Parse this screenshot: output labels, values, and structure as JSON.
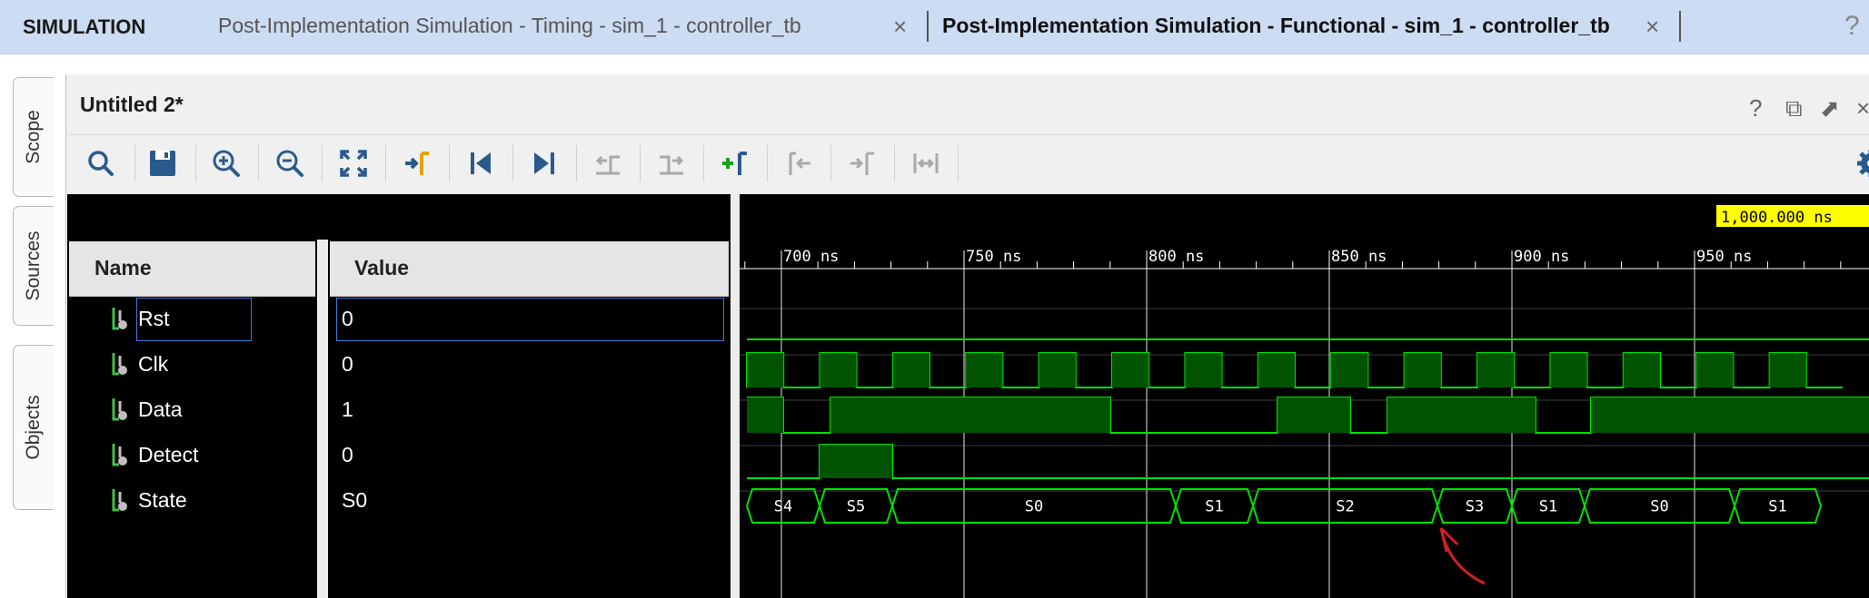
{
  "topbar": {
    "section": "SIMULATION",
    "tabs": [
      {
        "label": "Post-Implementation Simulation - Timing - sim_1 - controller_tb",
        "active": false
      },
      {
        "label": "Post-Implementation Simulation - Functional - sim_1 - controller_tb",
        "active": true
      }
    ],
    "close_glyph": "×",
    "help_glyph": "?"
  },
  "side_tabs": [
    "Scope",
    "Sources",
    "Objects"
  ],
  "panel": {
    "title": "Untitled 2*",
    "buttons": [
      "?",
      "⧉",
      "⬈",
      "×"
    ]
  },
  "toolbar": {
    "icons": [
      "search-icon",
      "save-icon",
      "zoom-in-icon",
      "zoom-out-icon",
      "zoom-fit-icon",
      "go-to-cursor-icon",
      "go-to-start-icon",
      "go-to-end-icon",
      "previous-transition-icon",
      "next-transition-icon",
      "add-marker-icon",
      "previous-marker-icon",
      "next-marker-icon",
      "swap-cursors-icon",
      "settings-icon"
    ]
  },
  "columns": {
    "name": "Name",
    "value": "Value"
  },
  "signals": [
    {
      "name": "Rst",
      "value": "0"
    },
    {
      "name": "Clk",
      "value": "0"
    },
    {
      "name": "Data",
      "value": "1"
    },
    {
      "name": "Detect",
      "value": "0"
    },
    {
      "name": "State",
      "value": "S0"
    }
  ],
  "wave": {
    "cursor_label": "1,000.000 ns",
    "time_labels": [
      "700 ns",
      "750 ns",
      "800 ns",
      "850 ns",
      "900 ns",
      "950 ns"
    ],
    "state_labels": [
      "S4",
      "S5",
      "S0",
      "S1",
      "S2",
      "S3",
      "S1",
      "S0",
      "S1"
    ],
    "colors": {
      "wave": "#00e000",
      "fill": "#005400",
      "background": "#000000",
      "grid": "#ffffff",
      "cursor_bg": "#ffff00",
      "annotation": "#d02020"
    }
  }
}
